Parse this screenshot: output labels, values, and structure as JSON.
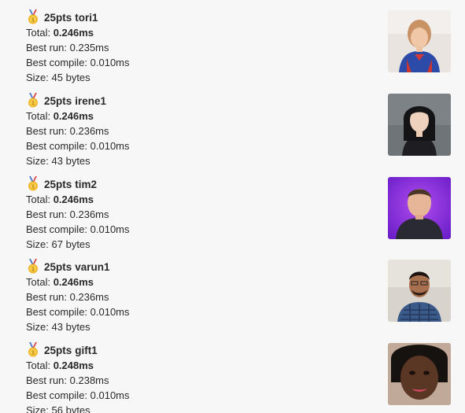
{
  "entries": [
    {
      "points": "25pts",
      "name": "tori1",
      "total_label": "Total:",
      "total": "0.246ms",
      "best_run": "Best run: 0.235ms",
      "best_compile": "Best compile: 0.010ms",
      "size": "Size: 45 bytes"
    },
    {
      "points": "25pts",
      "name": "irene1",
      "total_label": "Total:",
      "total": "0.246ms",
      "best_run": "Best run: 0.236ms",
      "best_compile": "Best compile: 0.010ms",
      "size": "Size: 43 bytes"
    },
    {
      "points": "25pts",
      "name": "tim2",
      "total_label": "Total:",
      "total": "0.246ms",
      "best_run": "Best run: 0.236ms",
      "best_compile": "Best compile: 0.010ms",
      "size": "Size: 67 bytes"
    },
    {
      "points": "25pts",
      "name": "varun1",
      "total_label": "Total:",
      "total": "0.246ms",
      "best_run": "Best run: 0.236ms",
      "best_compile": "Best compile: 0.010ms",
      "size": "Size: 43 bytes"
    },
    {
      "points": "25pts",
      "name": "gift1",
      "total_label": "Total:",
      "total": "0.248ms",
      "best_run": "Best run: 0.238ms",
      "best_compile": "Best compile: 0.010ms",
      "size": "Size: 56 bytes"
    }
  ]
}
